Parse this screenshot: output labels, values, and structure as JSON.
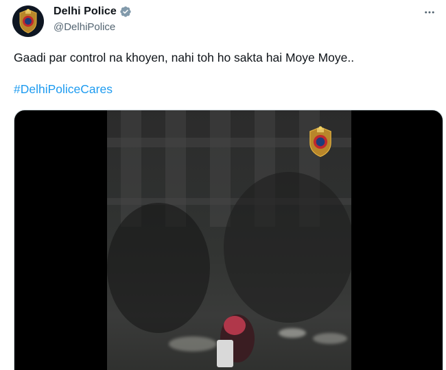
{
  "account": {
    "name": "Delhi Police",
    "handle": "@DelhiPolice",
    "verified": true,
    "avatar_icon": "delhi-police-emblem-icon"
  },
  "tweet": {
    "text": "Gaadi par control na khoyen, nahi toh ho sakta hai Moye Moye..",
    "hashtag": "#DelhiPoliceCares"
  },
  "media": {
    "type": "video",
    "watermark_icon": "delhi-police-emblem-icon"
  },
  "colors": {
    "link": "#1d9bf0",
    "verified": "#829aab",
    "secondary_text": "#536471",
    "primary_text": "#0f1419"
  },
  "icons": {
    "more": "more-options-icon",
    "verified": "verified-badge-icon"
  }
}
